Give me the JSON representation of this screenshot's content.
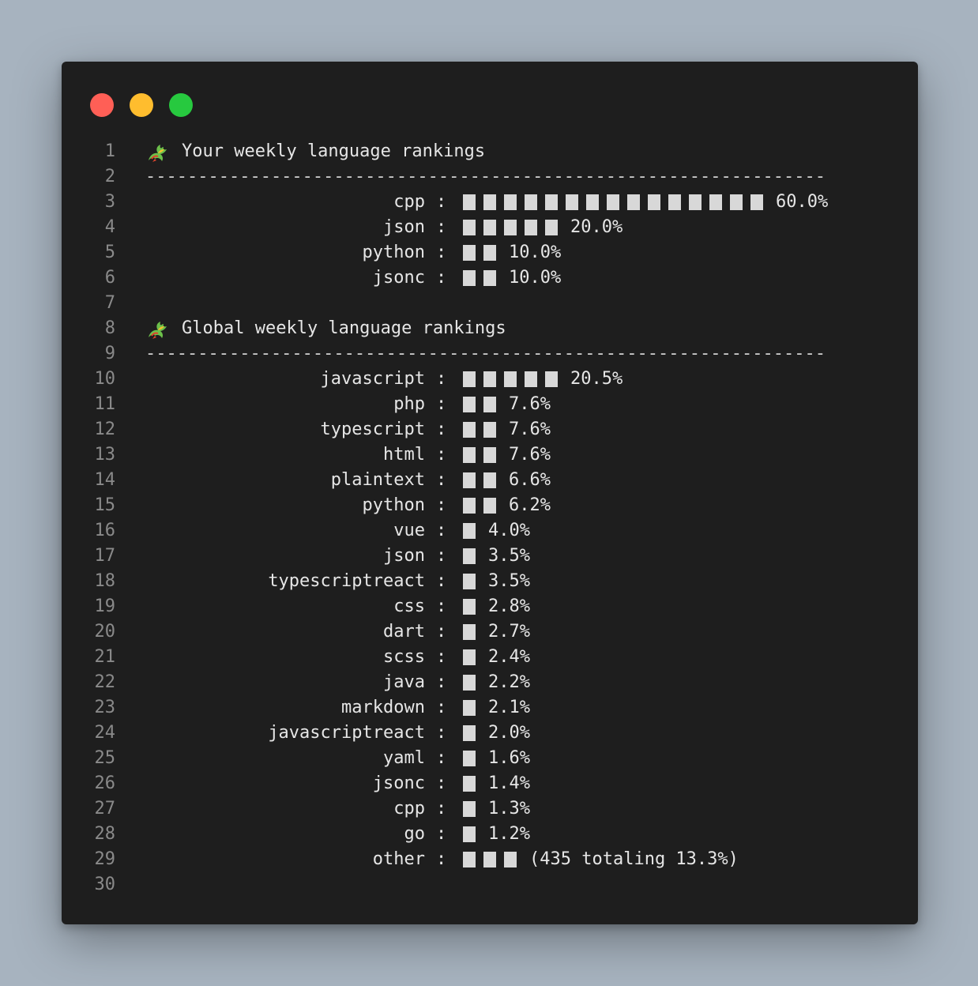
{
  "personal": {
    "title": "Your weekly language rankings",
    "items": [
      {
        "lang": "cpp",
        "blocks": 15,
        "pct": "60.0%"
      },
      {
        "lang": "json",
        "blocks": 5,
        "pct": "20.0%"
      },
      {
        "lang": "python",
        "blocks": 2,
        "pct": "10.0%"
      },
      {
        "lang": "jsonc",
        "blocks": 2,
        "pct": "10.0%"
      }
    ]
  },
  "global": {
    "title": "Global weekly language rankings",
    "items": [
      {
        "lang": "javascript",
        "blocks": 5,
        "pct": "20.5%"
      },
      {
        "lang": "php",
        "blocks": 2,
        "pct": "7.6%"
      },
      {
        "lang": "typescript",
        "blocks": 2,
        "pct": "7.6%"
      },
      {
        "lang": "html",
        "blocks": 2,
        "pct": "7.6%"
      },
      {
        "lang": "plaintext",
        "blocks": 2,
        "pct": "6.6%"
      },
      {
        "lang": "python",
        "blocks": 2,
        "pct": "6.2%"
      },
      {
        "lang": "vue",
        "blocks": 1,
        "pct": "4.0%"
      },
      {
        "lang": "json",
        "blocks": 1,
        "pct": "3.5%"
      },
      {
        "lang": "typescriptreact",
        "blocks": 1,
        "pct": "3.5%"
      },
      {
        "lang": "css",
        "blocks": 1,
        "pct": "2.8%"
      },
      {
        "lang": "dart",
        "blocks": 1,
        "pct": "2.7%"
      },
      {
        "lang": "scss",
        "blocks": 1,
        "pct": "2.4%"
      },
      {
        "lang": "java",
        "blocks": 1,
        "pct": "2.2%"
      },
      {
        "lang": "markdown",
        "blocks": 1,
        "pct": "2.1%"
      },
      {
        "lang": "javascriptreact",
        "blocks": 1,
        "pct": "2.0%"
      },
      {
        "lang": "yaml",
        "blocks": 1,
        "pct": "1.6%"
      },
      {
        "lang": "jsonc",
        "blocks": 1,
        "pct": "1.4%"
      },
      {
        "lang": "cpp",
        "blocks": 1,
        "pct": "1.3%"
      },
      {
        "lang": "go",
        "blocks": 1,
        "pct": "1.2%"
      },
      {
        "lang": "other",
        "blocks": 3,
        "pct": "(435 totaling 13.3%)"
      }
    ]
  },
  "rule": "-----------------------------------------------------------------",
  "line_count": 30,
  "colon": ":",
  "icon": "dragon-icon",
  "colors": {
    "background": "#a7b3bf",
    "window": "#1e1e1e",
    "text": "#e6e6e6",
    "line_number": "#8a8a8a",
    "bar": "#d8d8d8",
    "dot_red": "#ff5f56",
    "dot_yellow": "#ffbd2e",
    "dot_green": "#27c93f"
  }
}
